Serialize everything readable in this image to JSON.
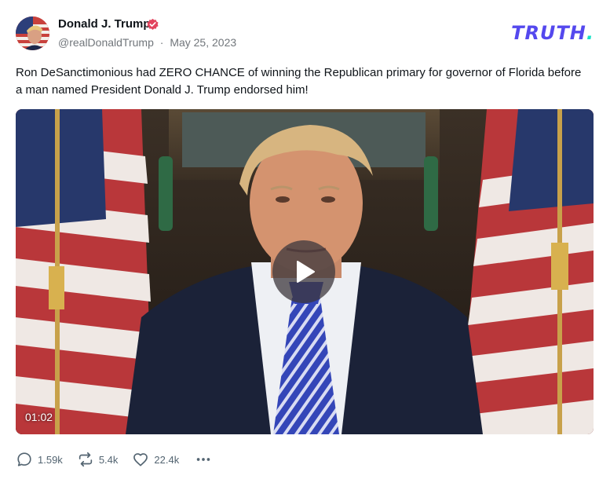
{
  "post": {
    "author": {
      "name": "Donald J. Trump",
      "verified_icon": "verified-badge-icon",
      "handle": "@realDonaldTrump",
      "separator": "·",
      "date": "May 25, 2023"
    },
    "brand": {
      "logo_text": "TRUTH",
      "logo_dot": ".",
      "logo_color": "#5448ee",
      "dot_color": "#17e2c7"
    },
    "text": "Ron DeSanctimonious had ZERO CHANCE of winning the Republican primary for governor of Florida before a man named President Donald J. Trump endorsed him!",
    "video": {
      "duration": "01:02",
      "play_icon": "play-icon"
    },
    "actions": {
      "replies": "1.59k",
      "retruths": "5.4k",
      "likes": "22.4k",
      "reply_icon": "reply-icon",
      "retruth_icon": "retruth-icon",
      "like_icon": "heart-icon",
      "more_icon": "more-icon"
    }
  }
}
